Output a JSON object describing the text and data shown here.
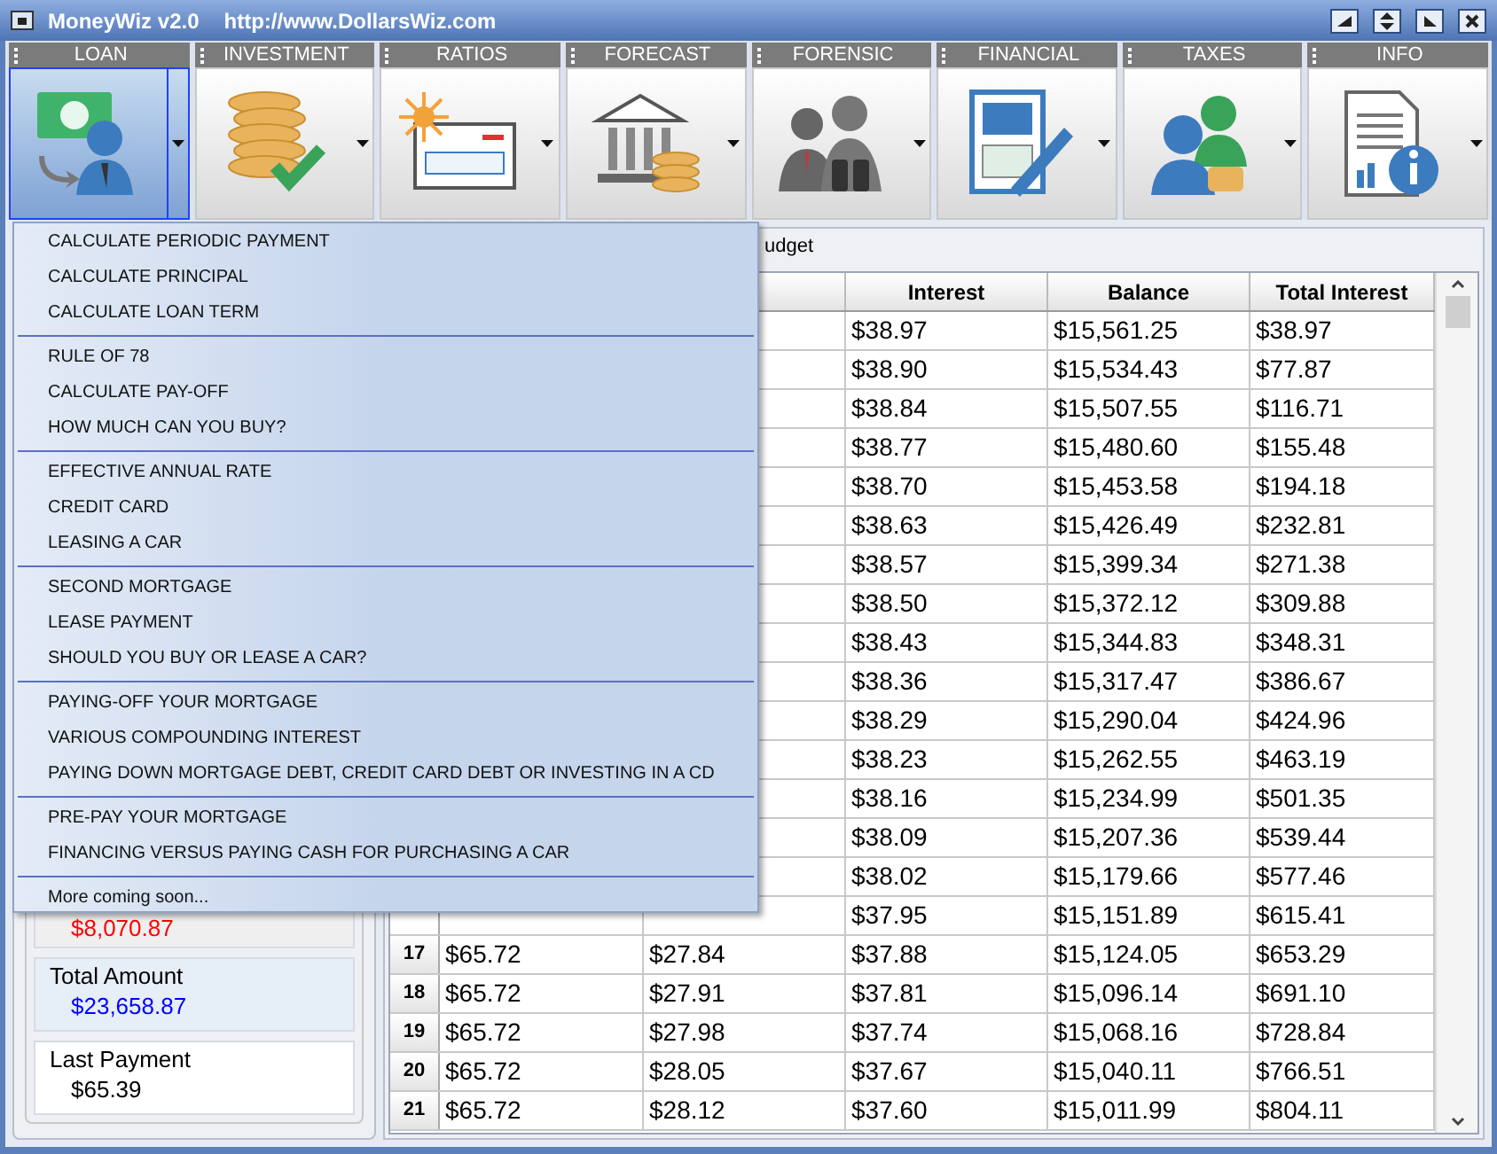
{
  "window": {
    "title": "MoneyWiz v2.0",
    "url": "http://www.DollarsWiz.com"
  },
  "tabs": [
    {
      "label": "LOAN",
      "kind": "loan",
      "selected": true
    },
    {
      "label": "INVESTMENT",
      "kind": "coins",
      "selected": false
    },
    {
      "label": "RATIOS",
      "kind": "check",
      "selected": false
    },
    {
      "label": "FORECAST",
      "kind": "bank",
      "selected": false
    },
    {
      "label": "FORENSIC",
      "kind": "people",
      "selected": false
    },
    {
      "label": "FINANCIAL",
      "kind": "notebook",
      "selected": false
    },
    {
      "label": "TAXES",
      "kind": "users",
      "selected": false
    },
    {
      "label": "INFO",
      "kind": "info",
      "selected": false
    }
  ],
  "menu": {
    "groups": [
      [
        "CALCULATE PERIODIC PAYMENT",
        "CALCULATE PRINCIPAL",
        "CALCULATE LOAN TERM"
      ],
      [
        "RULE OF 78",
        "CALCULATE PAY-OFF",
        "HOW MUCH CAN YOU BUY?"
      ],
      [
        "EFFECTIVE ANNUAL RATE",
        "CREDIT CARD",
        "LEASING A CAR"
      ],
      [
        "SECOND MORTGAGE",
        "LEASE PAYMENT",
        "SHOULD YOU BUY OR LEASE A CAR?"
      ],
      [
        "PAYING-OFF YOUR MORTGAGE",
        "VARIOUS COMPOUNDING INTEREST",
        "PAYING DOWN MORTGAGE DEBT, CREDIT CARD DEBT OR INVESTING IN A CD"
      ],
      [
        "PRE-PAY YOUR MORTGAGE",
        "FINANCING VERSUS PAYING CASH FOR PURCHASING A CAR"
      ],
      [
        "More coming soon..."
      ]
    ]
  },
  "content_tab": "udget",
  "summary": [
    {
      "value": "$8,070.87",
      "color": "#ff0000"
    },
    {
      "label": "Total Amount",
      "value": "$23,658.87",
      "color": "#0000ff"
    },
    {
      "label": "Last Payment",
      "value": "$65.39",
      "color": "#000000"
    }
  ],
  "table": {
    "columns": [
      "Interest",
      "Balance",
      "Total Interest"
    ],
    "rows": [
      {
        "interest": "$38.97",
        "balance": "$15,561.25",
        "total": "$38.97"
      },
      {
        "interest": "$38.90",
        "balance": "$15,534.43",
        "total": "$77.87"
      },
      {
        "interest": "$38.84",
        "balance": "$15,507.55",
        "total": "$116.71"
      },
      {
        "interest": "$38.77",
        "balance": "$15,480.60",
        "total": "$155.48"
      },
      {
        "interest": "$38.70",
        "balance": "$15,453.58",
        "total": "$194.18"
      },
      {
        "interest": "$38.63",
        "balance": "$15,426.49",
        "total": "$232.81"
      },
      {
        "interest": "$38.57",
        "balance": "$15,399.34",
        "total": "$271.38"
      },
      {
        "interest": "$38.50",
        "balance": "$15,372.12",
        "total": "$309.88"
      },
      {
        "interest": "$38.43",
        "balance": "$15,344.83",
        "total": "$348.31"
      },
      {
        "interest": "$38.36",
        "balance": "$15,317.47",
        "total": "$386.67"
      },
      {
        "interest": "$38.29",
        "balance": "$15,290.04",
        "total": "$424.96"
      },
      {
        "interest": "$38.23",
        "balance": "$15,262.55",
        "total": "$463.19"
      },
      {
        "interest": "$38.16",
        "balance": "$15,234.99",
        "total": "$501.35"
      },
      {
        "interest": "$38.09",
        "balance": "$15,207.36",
        "total": "$539.44"
      },
      {
        "interest": "$38.02",
        "balance": "$15,179.66",
        "total": "$577.46"
      },
      {
        "interest": "$37.95",
        "balance": "$15,151.89",
        "total": "$615.41"
      },
      {
        "number": "17",
        "payment": "$65.72",
        "principal": "$27.84",
        "interest": "$37.88",
        "balance": "$15,124.05",
        "total": "$653.29"
      },
      {
        "number": "18",
        "payment": "$65.72",
        "principal": "$27.91",
        "interest": "$37.81",
        "balance": "$15,096.14",
        "total": "$691.10"
      },
      {
        "number": "19",
        "payment": "$65.72",
        "principal": "$27.98",
        "interest": "$37.74",
        "balance": "$15,068.16",
        "total": "$728.84"
      },
      {
        "number": "20",
        "payment": "$65.72",
        "principal": "$28.05",
        "interest": "$37.67",
        "balance": "$15,040.11",
        "total": "$766.51"
      },
      {
        "number": "21",
        "payment": "$65.72",
        "principal": "$28.12",
        "interest": "$37.60",
        "balance": "$15,011.99",
        "total": "$804.11"
      }
    ]
  }
}
